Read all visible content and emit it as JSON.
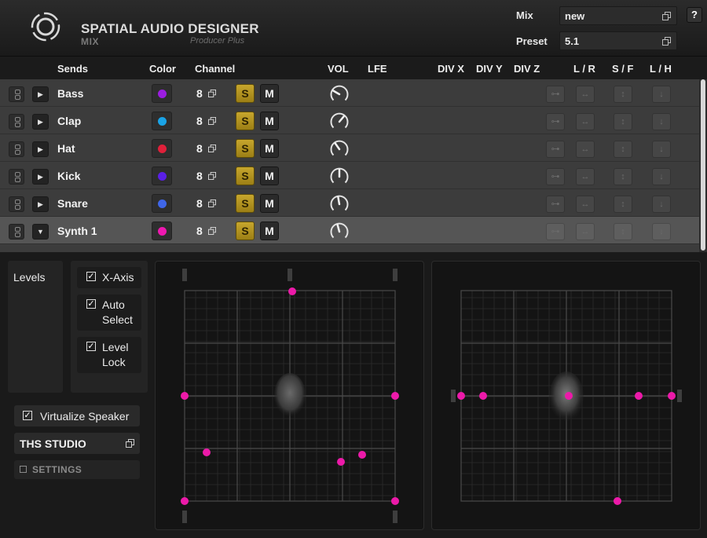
{
  "header": {
    "app_title": "SPATIAL AUDIO DESIGNER",
    "app_subtitle": "MIX",
    "app_edition": "Producer Plus",
    "mix_label": "Mix",
    "mix_value": "new",
    "preset_label": "Preset",
    "preset_value": "5.1",
    "help_label": "?"
  },
  "columns": {
    "sends": "Sends",
    "color": "Color",
    "channel": "Channel",
    "vol": "VOL",
    "lfe": "LFE",
    "divx": "DIV X",
    "divy": "DIV Y",
    "divz": "DIV Z",
    "lr": "L / R",
    "sf": "S / F",
    "lh": "L / H"
  },
  "tracks": [
    {
      "name": "Bass",
      "color": "#9b1de0",
      "channel": "8",
      "solo": "S",
      "mute": "M",
      "expanded": false,
      "selected": false,
      "vol_angle": -60
    },
    {
      "name": "Clap",
      "color": "#1aa3e6",
      "channel": "8",
      "solo": "S",
      "mute": "M",
      "expanded": false,
      "selected": false,
      "vol_angle": 40
    },
    {
      "name": "Hat",
      "color": "#e0203a",
      "channel": "8",
      "solo": "S",
      "mute": "M",
      "expanded": false,
      "selected": false,
      "vol_angle": -35
    },
    {
      "name": "Kick",
      "color": "#5a1fe6",
      "channel": "8",
      "solo": "S",
      "mute": "M",
      "expanded": false,
      "selected": false,
      "vol_angle": 0
    },
    {
      "name": "Snare",
      "color": "#3f66e8",
      "channel": "8",
      "solo": "S",
      "mute": "M",
      "expanded": false,
      "selected": false,
      "vol_angle": -10
    },
    {
      "name": "Synth 1",
      "color": "#ee18b0",
      "channel": "8",
      "solo": "S",
      "mute": "M",
      "expanded": true,
      "selected": true,
      "vol_angle": -15
    }
  ],
  "controls": {
    "levels_label": "Levels",
    "x_axis": "X-Axis",
    "auto_select_1": "Auto",
    "auto_select_2": "Select",
    "level_lock_1": "Level",
    "level_lock_2": "Lock",
    "check_mark": "✓",
    "virtualize_speaker": "Virtualize Speaker",
    "studio": "THS STUDIO",
    "settings": "SETTINGS"
  },
  "colors": {
    "accent": "#ec1aa9",
    "solo": "#b8971f"
  },
  "views": {
    "top_view_icon": "head-top-icon",
    "front_view_icon": "head-front-icon"
  }
}
